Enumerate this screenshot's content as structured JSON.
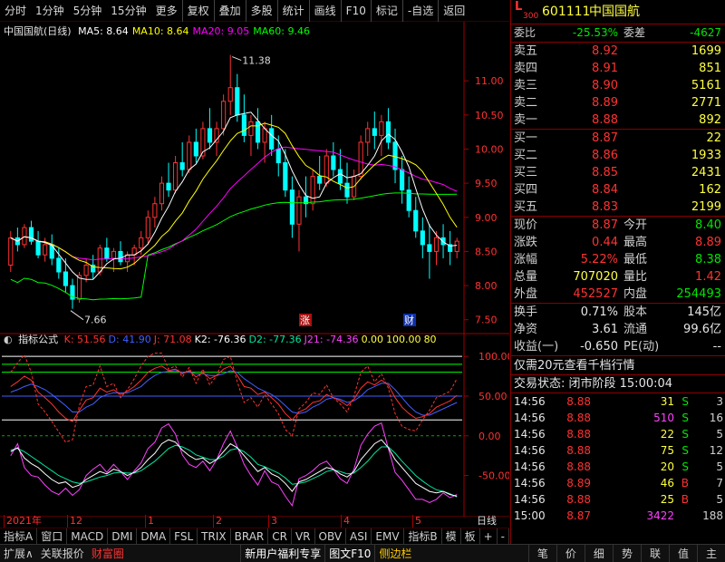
{
  "toolbar": {
    "items": [
      "分时",
      "1分钟",
      "5分钟",
      "15分钟",
      "更多",
      "复权",
      "叠加",
      "多股",
      "统计",
      "画线",
      "F10",
      "标记",
      "-自选",
      "返回"
    ]
  },
  "colors": {
    "bg": "#000000",
    "up": "#ff3232",
    "down": "#00ffff",
    "ma5": "#ffffff",
    "ma10": "#ffff00",
    "ma20": "#ff00ff",
    "ma60": "#00ff00",
    "grid": "#8b0000"
  },
  "chart": {
    "title": "中国国航(日线)",
    "ma_legend": [
      {
        "label": "MA5: 8.64",
        "color": "#ffffff"
      },
      {
        "label": "MA10: 8.64",
        "color": "#ffff00"
      },
      {
        "label": "MA20: 9.05",
        "color": "#ff00ff"
      },
      {
        "label": "MA60: 9.46",
        "color": "#00ff00"
      }
    ],
    "high_label": "11.38",
    "low_label": "7.66",
    "price_ticks": [
      "11.00",
      "10.50",
      "10.00",
      "9.50",
      "9.00",
      "8.50",
      "8.00",
      "7.50"
    ],
    "badge_up": "涨",
    "badge_fin": "财"
  },
  "chart_data": {
    "type": "candlestick",
    "ylim": [
      7.35,
      11.6
    ],
    "candles": [
      [
        8.3,
        8.8,
        8.2,
        8.7
      ],
      [
        8.7,
        8.85,
        8.5,
        8.6
      ],
      [
        8.6,
        8.9,
        8.55,
        8.85
      ],
      [
        8.85,
        8.95,
        8.6,
        8.65
      ],
      [
        8.65,
        8.8,
        8.4,
        8.45
      ],
      [
        8.45,
        8.7,
        8.35,
        8.6
      ],
      [
        8.6,
        8.75,
        8.3,
        8.4
      ],
      [
        8.4,
        8.55,
        8.1,
        8.2
      ],
      [
        8.2,
        8.4,
        7.9,
        8.0
      ],
      [
        8.0,
        8.1,
        7.66,
        7.8
      ],
      [
        7.8,
        8.2,
        7.75,
        8.15
      ],
      [
        8.15,
        8.4,
        8.05,
        8.3
      ],
      [
        8.3,
        8.45,
        8.1,
        8.2
      ],
      [
        8.2,
        8.6,
        8.15,
        8.55
      ],
      [
        8.55,
        8.7,
        8.35,
        8.4
      ],
      [
        8.4,
        8.55,
        8.2,
        8.5
      ],
      [
        8.5,
        8.65,
        8.3,
        8.35
      ],
      [
        8.35,
        8.5,
        8.2,
        8.45
      ],
      [
        8.45,
        8.6,
        8.3,
        8.55
      ],
      [
        8.55,
        8.8,
        8.45,
        8.7
      ],
      [
        8.7,
        9.1,
        8.6,
        9.0
      ],
      [
        9.0,
        9.3,
        8.85,
        9.2
      ],
      [
        9.2,
        9.6,
        9.1,
        9.5
      ],
      [
        9.5,
        9.8,
        9.3,
        9.4
      ],
      [
        9.4,
        9.9,
        9.35,
        9.8
      ],
      [
        9.8,
        10.1,
        9.6,
        9.7
      ],
      [
        9.7,
        10.2,
        9.65,
        10.1
      ],
      [
        10.1,
        10.3,
        9.8,
        9.9
      ],
      [
        9.9,
        10.4,
        9.85,
        10.3
      ],
      [
        10.3,
        10.6,
        10.0,
        10.1
      ],
      [
        10.1,
        10.4,
        9.9,
        10.3
      ],
      [
        10.3,
        10.8,
        10.2,
        10.7
      ],
      [
        10.7,
        11.38,
        10.5,
        10.9
      ],
      [
        10.9,
        11.1,
        10.4,
        10.5
      ],
      [
        10.5,
        10.8,
        10.1,
        10.2
      ],
      [
        10.2,
        10.5,
        9.9,
        10.4
      ],
      [
        10.4,
        10.6,
        10.0,
        10.1
      ],
      [
        10.1,
        10.4,
        9.8,
        10.3
      ],
      [
        10.3,
        10.5,
        9.9,
        10.0
      ],
      [
        10.0,
        10.2,
        9.6,
        9.8
      ],
      [
        9.8,
        10.0,
        9.3,
        9.4
      ],
      [
        9.4,
        9.6,
        8.7,
        8.9
      ],
      [
        8.9,
        9.4,
        8.5,
        9.3
      ],
      [
        9.3,
        9.6,
        9.0,
        9.2
      ],
      [
        9.2,
        9.7,
        9.1,
        9.6
      ],
      [
        9.6,
        9.9,
        9.4,
        9.5
      ],
      [
        9.5,
        10.0,
        9.45,
        9.9
      ],
      [
        9.9,
        10.1,
        9.6,
        9.7
      ],
      [
        9.7,
        10.0,
        9.4,
        9.5
      ],
      [
        9.5,
        9.8,
        9.2,
        9.3
      ],
      [
        9.3,
        9.7,
        9.25,
        9.6
      ],
      [
        9.6,
        10.2,
        9.55,
        10.1
      ],
      [
        10.1,
        10.4,
        9.9,
        10.3
      ],
      [
        10.3,
        10.55,
        10.0,
        10.2
      ],
      [
        10.2,
        10.5,
        9.9,
        10.4
      ],
      [
        10.4,
        10.6,
        10.0,
        10.1
      ],
      [
        10.1,
        10.3,
        9.5,
        9.7
      ],
      [
        9.7,
        9.9,
        9.2,
        9.4
      ],
      [
        9.4,
        9.6,
        9.0,
        9.1
      ],
      [
        9.1,
        9.3,
        8.7,
        8.8
      ],
      [
        8.8,
        9.0,
        8.4,
        8.6
      ],
      [
        8.6,
        8.9,
        8.1,
        8.5
      ],
      [
        8.5,
        8.8,
        8.3,
        8.7
      ],
      [
        8.7,
        8.9,
        8.4,
        8.6
      ],
      [
        8.6,
        8.8,
        8.3,
        8.5
      ],
      [
        8.5,
        8.7,
        8.4,
        8.65
      ]
    ],
    "kdj": {
      "axis_ticks": [
        "100.00",
        "50.00",
        "0.00",
        "-50.00"
      ],
      "ylim": [
        -95,
        115
      ],
      "hlines": [
        100,
        90,
        80,
        50,
        20,
        0
      ],
      "K": [
        62,
        68,
        75,
        70,
        55,
        48,
        40,
        30,
        22,
        18,
        32,
        45,
        48,
        60,
        55,
        58,
        52,
        56,
        62,
        70,
        80,
        85,
        88,
        82,
        84,
        78,
        82,
        74,
        80,
        72,
        76,
        84,
        88,
        76,
        62,
        60,
        52,
        55,
        48,
        40,
        28,
        20,
        30,
        34,
        42,
        44,
        52,
        48,
        44,
        38,
        46,
        60,
        68,
        64,
        70,
        64,
        48,
        36,
        28,
        22,
        24,
        28,
        36,
        40,
        44,
        51
      ],
      "D": [
        55,
        58,
        62,
        65,
        62,
        58,
        52,
        45,
        38,
        30,
        30,
        36,
        40,
        48,
        52,
        54,
        54,
        54,
        58,
        62,
        70,
        76,
        80,
        81,
        82,
        80,
        80,
        78,
        78,
        76,
        76,
        78,
        82,
        80,
        72,
        66,
        60,
        56,
        52,
        46,
        38,
        30,
        28,
        30,
        36,
        40,
        46,
        48,
        46,
        42,
        44,
        50,
        58,
        62,
        66,
        66,
        58,
        48,
        38,
        30,
        26,
        26,
        30,
        34,
        38,
        42
      ],
      "J": [
        80,
        92,
        102,
        80,
        40,
        30,
        18,
        5,
        -8,
        -5,
        38,
        62,
        64,
        88,
        62,
        66,
        48,
        58,
        72,
        88,
        100,
        104,
        104,
        84,
        88,
        74,
        86,
        66,
        84,
        64,
        76,
        96,
        100,
        68,
        42,
        48,
        36,
        52,
        40,
        28,
        8,
        0,
        34,
        42,
        54,
        52,
        64,
        48,
        40,
        30,
        50,
        80,
        88,
        68,
        78,
        60,
        28,
        12,
        8,
        6,
        20,
        32,
        48,
        52,
        56,
        72
      ],
      "K2": [
        -20,
        -15,
        -28,
        -35,
        -40,
        -48,
        -55,
        -60,
        -58,
        -65,
        -62,
        -55,
        -50,
        -45,
        -48,
        -42,
        -45,
        -50,
        -46,
        -40,
        -30,
        -22,
        -10,
        -5,
        -8,
        -18,
        -25,
        -30,
        -28,
        -35,
        -30,
        -20,
        -10,
        -15,
        -25,
        -35,
        -45,
        -40,
        -48,
        -52,
        -60,
        -70,
        -58,
        -55,
        -50,
        -45,
        -40,
        -42,
        -48,
        -52,
        -45,
        -30,
        -20,
        -10,
        -5,
        -15,
        -30,
        -40,
        -50,
        -60,
        -65,
        -70,
        -72,
        -70,
        -74,
        -76
      ],
      "D2": [
        -18,
        -16,
        -20,
        -26,
        -32,
        -38,
        -44,
        -50,
        -54,
        -58,
        -60,
        -58,
        -55,
        -52,
        -50,
        -47,
        -46,
        -47,
        -47,
        -44,
        -38,
        -32,
        -24,
        -16,
        -12,
        -14,
        -18,
        -24,
        -27,
        -30,
        -30,
        -26,
        -18,
        -16,
        -20,
        -27,
        -36,
        -39,
        -43,
        -47,
        -53,
        -61,
        -60,
        -58,
        -54,
        -50,
        -45,
        -43,
        -45,
        -48,
        -47,
        -40,
        -32,
        -22,
        -14,
        -14,
        -22,
        -32,
        -41,
        -50,
        -57,
        -63,
        -68,
        -70,
        -73,
        -77
      ],
      "J21": [
        -25,
        -10,
        -40,
        -50,
        -52,
        -62,
        -70,
        -74,
        -66,
        -75,
        -68,
        -50,
        -42,
        -36,
        -46,
        -36,
        -45,
        -55,
        -44,
        -34,
        -16,
        -8,
        10,
        15,
        2,
        -24,
        -36,
        -40,
        -32,
        -44,
        -30,
        -10,
        6,
        -14,
        -36,
        -50,
        -62,
        -44,
        -58,
        -62,
        -76,
        -88,
        -54,
        -50,
        -44,
        -36,
        -32,
        -42,
        -54,
        -60,
        -42,
        -12,
        2,
        12,
        16,
        -16,
        -46,
        -56,
        -68,
        -80,
        -80,
        -84,
        -80,
        -72,
        -78,
        -74
      ]
    }
  },
  "indicator": {
    "title": "指标公式",
    "legend": [
      {
        "label": "K: 51.56",
        "color": "#ff3232"
      },
      {
        "label": "D: 41.90",
        "color": "#4060ff"
      },
      {
        "label": "J: 71.08",
        "color": "#ff3232"
      },
      {
        "label": "K2: -76.36",
        "color": "#ffffff"
      },
      {
        "label": "D2: -77.36",
        "color": "#00e6a0"
      },
      {
        "label": "J21: -74.36",
        "color": "#ff40ff"
      },
      {
        "label": "0.00",
        "color": "#ffff40"
      },
      {
        "label": "100.00",
        "color": "#ffff40"
      },
      {
        "label": "80",
        "color": "#ffff40"
      }
    ]
  },
  "time_axis": {
    "labels": [
      "2021年",
      "12",
      "1",
      "2",
      "3",
      "4",
      "5"
    ],
    "right_label": "日线"
  },
  "bottombar": {
    "items": [
      "指标A",
      "窗口",
      "MACD",
      "DMI",
      "DMA",
      "FSL",
      "TRIX",
      "BRAR",
      "CR",
      "VR",
      "OBV",
      "ASI",
      "EMV",
      "指标B",
      "模",
      "板",
      "+",
      "-"
    ]
  },
  "statusbar": {
    "items": [
      {
        "label": "扩展∧",
        "style": ""
      },
      {
        "label": "关联报价",
        "style": ""
      },
      {
        "label": "财富圈",
        "style": "hl"
      }
    ],
    "promo": "新用户福利专享",
    "f10": "图文F10",
    "sidebar": "侧边栏",
    "right_items": [
      "笔",
      "价",
      "细",
      "势",
      "联",
      "值",
      "主"
    ]
  },
  "panel": {
    "market_tag": "L",
    "market_sub": "300",
    "code": "601111",
    "name": "中国国航",
    "weibi_label": "委比",
    "weibi_value": "-25.53%",
    "weicha_label": "委差",
    "weicha_value": "-4627",
    "asks": [
      {
        "label": "卖五",
        "price": "8.92",
        "vol": "1699"
      },
      {
        "label": "卖四",
        "price": "8.91",
        "vol": "851"
      },
      {
        "label": "卖三",
        "price": "8.90",
        "vol": "5161"
      },
      {
        "label": "卖二",
        "price": "8.89",
        "vol": "2771"
      },
      {
        "label": "卖一",
        "price": "8.88",
        "vol": "892"
      }
    ],
    "bids": [
      {
        "label": "买一",
        "price": "8.87",
        "vol": "22"
      },
      {
        "label": "买二",
        "price": "8.86",
        "vol": "1933"
      },
      {
        "label": "买三",
        "price": "8.85",
        "vol": "2431"
      },
      {
        "label": "买四",
        "price": "8.84",
        "vol": "162"
      },
      {
        "label": "买五",
        "price": "8.83",
        "vol": "2199"
      }
    ],
    "quote": [
      {
        "l1": "现价",
        "v1": "8.87",
        "c1": "red",
        "l2": "今开",
        "v2": "8.40",
        "c2": "green"
      },
      {
        "l1": "涨跌",
        "v1": "0.44",
        "c1": "red",
        "l2": "最高",
        "v2": "8.89",
        "c2": "red"
      },
      {
        "l1": "涨幅",
        "v1": "5.22%",
        "c1": "red",
        "l2": "最低",
        "v2": "8.38",
        "c2": "green"
      },
      {
        "l1": "总量",
        "v1": "707020",
        "c1": "yellow",
        "l2": "量比",
        "v2": "1.42",
        "c2": "red"
      },
      {
        "l1": "外盘",
        "v1": "452527",
        "c1": "red",
        "l2": "内盘",
        "v2": "254493",
        "c2": "green"
      }
    ],
    "stats": [
      {
        "l1": "换手",
        "v1": "0.71%",
        "l2": "股本",
        "v2": "145亿"
      },
      {
        "l1": "净资",
        "v1": "3.61",
        "l2": "流通",
        "v2": "99.6亿"
      },
      {
        "l1": "收益(一)",
        "v1": "-0.650",
        "l2": "PE(动)",
        "v2": "--"
      }
    ],
    "promo": "仅需20元查看千档行情",
    "trade_status": "交易状态: 闭市阶段 15:00:04",
    "ticks": [
      {
        "time": "14:56",
        "price": "8.88",
        "vol": "31",
        "vc": "yellow",
        "bs": "S",
        "bsc": "green",
        "n": "3"
      },
      {
        "time": "14:56",
        "price": "8.88",
        "vol": "510",
        "vc": "magenta",
        "bs": "S",
        "bsc": "green",
        "n": "16"
      },
      {
        "time": "14:56",
        "price": "8.88",
        "vol": "22",
        "vc": "yellow",
        "bs": "S",
        "bsc": "green",
        "n": "5"
      },
      {
        "time": "14:56",
        "price": "8.88",
        "vol": "75",
        "vc": "yellow",
        "bs": "S",
        "bsc": "green",
        "n": "12"
      },
      {
        "time": "14:56",
        "price": "8.88",
        "vol": "20",
        "vc": "yellow",
        "bs": "S",
        "bsc": "green",
        "n": "5"
      },
      {
        "time": "14:56",
        "price": "8.89",
        "vol": "46",
        "vc": "yellow",
        "bs": "B",
        "bsc": "red",
        "n": "7"
      },
      {
        "time": "14:56",
        "price": "8.88",
        "vol": "25",
        "vc": "yellow",
        "bs": "B",
        "bsc": "red",
        "n": "5"
      },
      {
        "time": "15:00",
        "price": "8.87",
        "vol": "3422",
        "vc": "magenta",
        "bs": "",
        "bsc": "white",
        "n": "188"
      }
    ]
  }
}
